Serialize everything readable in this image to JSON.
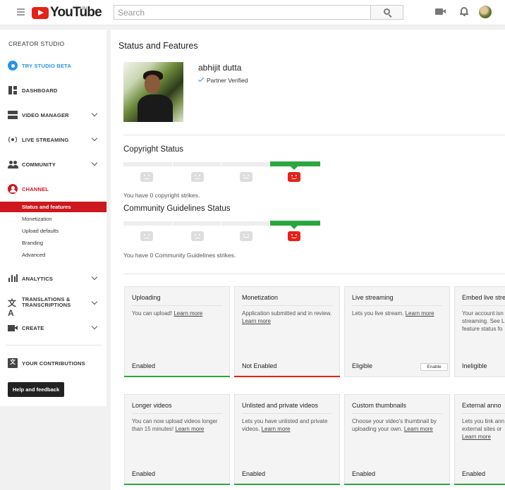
{
  "topbar": {
    "logo_text": "YouTube",
    "country": "IN",
    "search_placeholder": "Search"
  },
  "sidebar": {
    "title": "CREATOR STUDIO",
    "items": [
      {
        "label": "TRY STUDIO BETA",
        "icon": "gear-icon",
        "color": "#2793e6"
      },
      {
        "label": "DASHBOARD",
        "icon": "dashboard-icon"
      },
      {
        "label": "VIDEO MANAGER",
        "icon": "video-manager-icon"
      },
      {
        "label": "LIVE STREAMING",
        "icon": "live-streaming-icon"
      },
      {
        "label": "COMMUNITY",
        "icon": "community-icon"
      },
      {
        "label": "CHANNEL",
        "icon": "channel-icon",
        "color": "#cc181e"
      },
      {
        "label": "ANALYTICS",
        "icon": "analytics-icon"
      },
      {
        "label": "TRANSLATIONS & TRANSCRIPTIONS",
        "icon": "translate-icon"
      },
      {
        "label": "CREATE",
        "icon": "create-icon"
      },
      {
        "label": "YOUR CONTRIBUTIONS",
        "icon": "contributions-icon"
      }
    ],
    "channel_sub": [
      "Status and features",
      "Monetization",
      "Upload defaults",
      "Branding",
      "Advanced"
    ],
    "help_label": "Help and feedback"
  },
  "main": {
    "title": "Status and Features",
    "profile": {
      "name": "abhijit dutta",
      "verified": "Partner Verified"
    },
    "copyright": {
      "title": "Copyright Status",
      "text": "You have 0 copyright strikes."
    },
    "community": {
      "title": "Community Guidelines Status",
      "text": "You have 0 Community Guidelines strikes."
    },
    "cards": [
      {
        "title": "Uploading",
        "desc": "You can upload!",
        "link": "Learn more",
        "status": "Enabled",
        "bar": "green"
      },
      {
        "title": "Monetization",
        "desc": "Application submitted and in review.",
        "link": "Learn more",
        "status": "Not Enabled",
        "bar": "red"
      },
      {
        "title": "Live streaming",
        "desc": "Lets you live stream.",
        "link": "Learn more",
        "status": "Eligible",
        "button": "Enable"
      },
      {
        "title": "Embed live stre",
        "desc": "Your account isn",
        "desc2": "streaming. See L",
        "desc3": "feature status fo",
        "status": "Ineligible"
      },
      {
        "title": "Longer videos",
        "desc": "You can now upload videos longer than 15 minutes!",
        "link": "Learn more",
        "status": "Enabled",
        "bar": "green"
      },
      {
        "title": "Unlisted and private videos",
        "desc": "Lets you have unlisted and private videos.",
        "link": "Learn more",
        "status": "Enabled",
        "bar": "green"
      },
      {
        "title": "Custom thumbnails",
        "desc": "Choose your video's thumbnail by uploading your own.",
        "link": "Learn more",
        "status": "Enabled",
        "bar": "green"
      },
      {
        "title": "External anno",
        "desc": "Lets you link ann",
        "desc2": "external sites or",
        "link": "Learn more",
        "status": "Enabled",
        "bar": "green"
      }
    ]
  }
}
